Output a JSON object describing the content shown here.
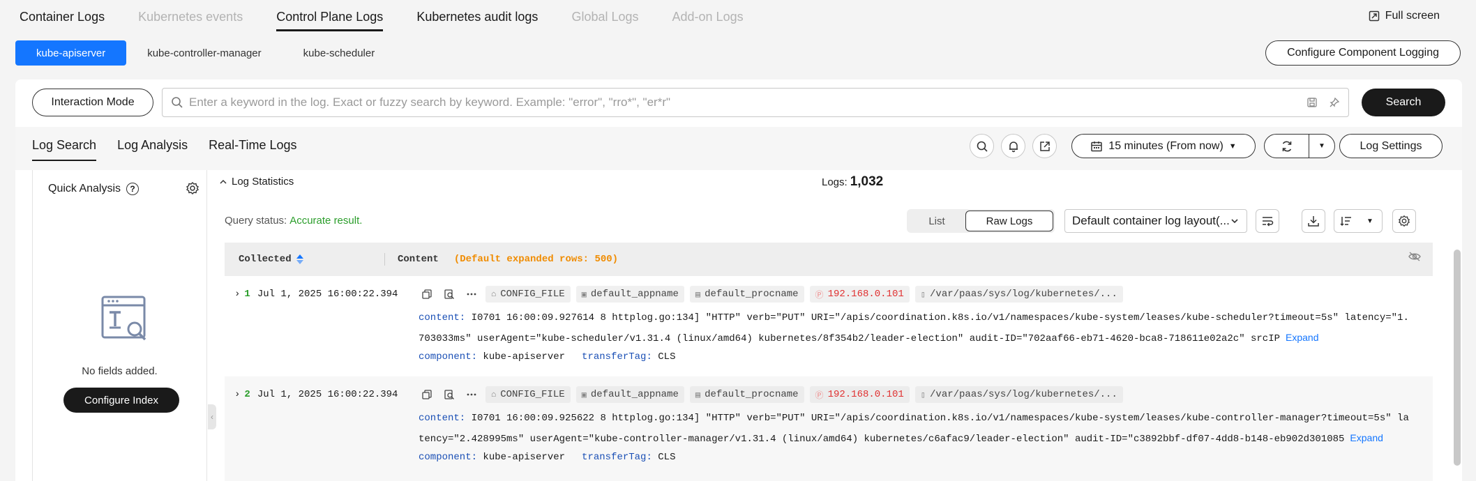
{
  "top_tabs": [
    {
      "label": "Container Logs",
      "state": "normal"
    },
    {
      "label": "Kubernetes events",
      "state": "disabled"
    },
    {
      "label": "Control Plane Logs",
      "state": "active"
    },
    {
      "label": "Kubernetes audit logs",
      "state": "normal"
    },
    {
      "label": "Global Logs",
      "state": "disabled"
    },
    {
      "label": "Add-on Logs",
      "state": "disabled"
    }
  ],
  "fullscreen_label": "Full screen",
  "components": [
    "kube-apiserver",
    "kube-controller-manager",
    "kube-scheduler"
  ],
  "configure_component_logging": "Configure Component Logging",
  "interaction_mode": "Interaction Mode",
  "search": {
    "placeholder": "Enter a keyword in the log. Exact or fuzzy search by keyword. Example: \"error\", \"rro*\", \"er*r\"",
    "button": "Search"
  },
  "subtabs": [
    "Log Search",
    "Log Analysis",
    "Real-Time Logs"
  ],
  "time_range": "15 minutes (From now)",
  "log_settings": "Log Settings",
  "quick_analysis": {
    "title": "Quick Analysis",
    "empty_text": "No fields added.",
    "configure_index": "Configure Index"
  },
  "log_statistics": "Log Statistics",
  "logs_label": "Logs:",
  "logs_count": "1,032",
  "query_status_label": "Query status:",
  "query_status_value": "Accurate result.",
  "view_modes": [
    "List",
    "Raw Logs"
  ],
  "layout_select": "Default container log layout(...",
  "table": {
    "collected": "Collected",
    "content": "Content",
    "content_hint": "(Default expanded rows: 500)"
  },
  "rows": [
    {
      "index": "1",
      "time": "Jul 1, 2025 16:00:22.394",
      "tags": [
        "CONFIG_FILE",
        "default_appname",
        "default_procname",
        "192.168.0.101",
        "/var/paas/sys/log/kubernetes/..."
      ],
      "content_key": "content:",
      "content": "I0701 16:00:09.927614       8 httplog.go:134] \"HTTP\" verb=\"PUT\" URI=\"/apis/coordination.k8s.io/v1/namespaces/kube-system/leases/kube-scheduler?timeout=5s\" latency=\"1.703033ms\" userAgent=\"kube-scheduler/v1.31.4 (linux/amd64) kubernetes/8f354b2/leader-election\" audit-ID=\"702aaf66-eb71-4620-bca8-718611e02a2c\" srcIP",
      "expand": "Expand",
      "component_key": "component:",
      "component": "kube-apiserver",
      "transfer_key": "transferTag:",
      "transfer": "CLS"
    },
    {
      "index": "2",
      "time": "Jul 1, 2025 16:00:22.394",
      "tags": [
        "CONFIG_FILE",
        "default_appname",
        "default_procname",
        "192.168.0.101",
        "/var/paas/sys/log/kubernetes/..."
      ],
      "content_key": "content:",
      "content": "I0701 16:00:09.925622       8 httplog.go:134] \"HTTP\" verb=\"PUT\" URI=\"/apis/coordination.k8s.io/v1/namespaces/kube-system/leases/kube-controller-manager?timeout=5s\" latency=\"2.428995ms\" userAgent=\"kube-controller-manager/v1.31.4 (linux/amd64) kubernetes/c6afac9/leader-election\" audit-ID=\"c3892bbf-df07-4dd8-b148-eb902d301085",
      "expand": "Expand",
      "component_key": "component:",
      "component": "kube-apiserver",
      "transfer_key": "transferTag:",
      "transfer": "CLS"
    }
  ],
  "colors": {
    "accent": "#1476ff",
    "dark_button": "#1a1a1a",
    "success": "#2a9d2a",
    "ip": "#e03030",
    "hint": "#f08c00"
  }
}
